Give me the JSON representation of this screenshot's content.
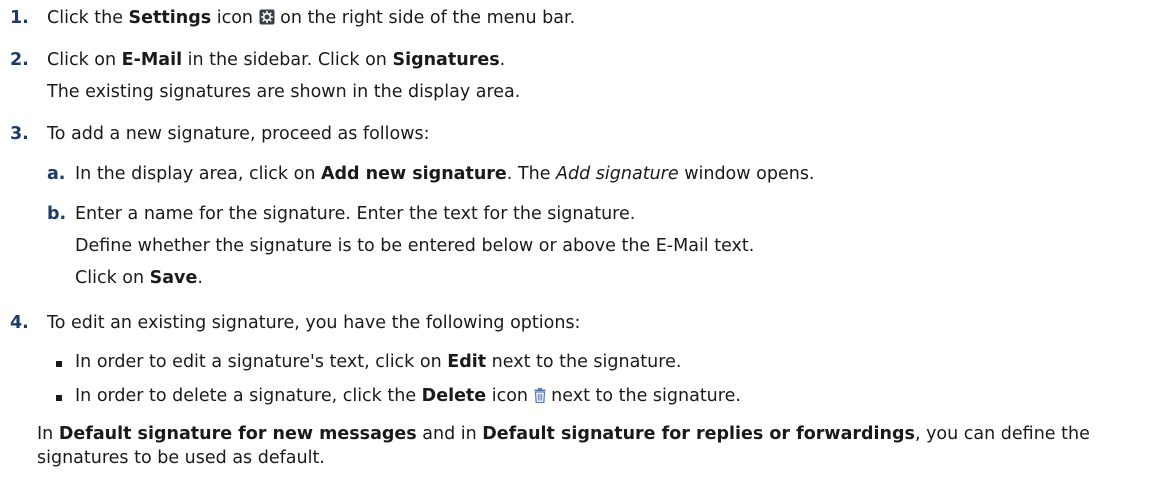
{
  "steps": [
    {
      "number": "1.",
      "pre": "Click the ",
      "bold": "Settings",
      "mid": " icon",
      "icon": "gear-icon",
      "post": " on the right side of the menu bar."
    },
    {
      "number": "2.",
      "pre": "Click on ",
      "bold1": "E-Mail",
      "mid": " in the sidebar. Click on ",
      "bold2": "Signatures",
      "post": ".",
      "note": "The existing signatures are shown in the display area."
    },
    {
      "number": "3.",
      "text": "To add a new signature, proceed as follows:",
      "substeps": [
        {
          "label": "a.",
          "pre": "In the display area, click on ",
          "bold": "Add new signature",
          "mid": ". The ",
          "italic": "Add signature",
          "post": " window opens."
        },
        {
          "label": "b.",
          "line1": "Enter a name for the signature. Enter the text for the signature.",
          "line2": "Define whether the signature is to be entered below or above the E-Mail text.",
          "line3_pre": "Click on ",
          "line3_bold": "Save",
          "line3_post": "."
        }
      ]
    },
    {
      "number": "4.",
      "text": "To edit an existing signature, you have the following options:",
      "bullets": [
        {
          "pre": "In order to edit a signature's text, click on ",
          "bold": "Edit",
          "post": " next to the signature."
        },
        {
          "pre": "In order to delete a signature, click the ",
          "bold": "Delete",
          "mid": " icon",
          "icon": "trash-icon",
          "post": " next to the signature."
        }
      ],
      "footer": {
        "pre": "In ",
        "bold1": "Default signature for new messages",
        "mid": " and in ",
        "bold2": "Default signature for replies or forwardings",
        "post": ", you can define the signatures to be used as default."
      }
    }
  ],
  "colors": {
    "number": "#1d3a6b",
    "text": "#1a1a1a",
    "icon_gear": "#3a3f47",
    "icon_trash": "#5a7ab8"
  }
}
